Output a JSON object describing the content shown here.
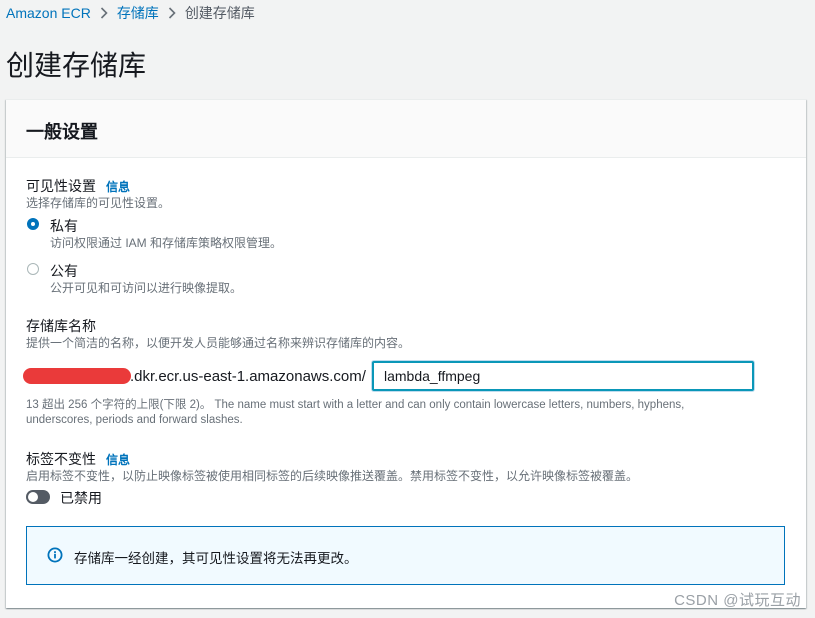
{
  "breadcrumb": {
    "root": "Amazon ECR",
    "parent": "存储库",
    "current": "创建存储库"
  },
  "page_title": "创建存储库",
  "general": {
    "title": "一般设置",
    "visibility": {
      "label": "可见性设置",
      "info": "信息",
      "description": "选择存储库的可见性设置。",
      "options": [
        {
          "label": "私有",
          "description": "访问权限通过 IAM 和存储库策略权限管理。",
          "selected": true
        },
        {
          "label": "公有",
          "description": "公开可见和可访问以进行映像提取。",
          "selected": false
        }
      ]
    },
    "repo_name": {
      "label": "存储库名称",
      "description": "提供一个简洁的名称，以便开发人员能够通过名称来辨识存储库的内容。",
      "uri_suffix": ".dkr.ecr.us-east-1.amazonaws.com/",
      "value": "lambda_ffmpeg",
      "constraint": "13 超出 256 个字符的上限(下限 2)。 The name must start with a letter and can only contain lowercase letters, numbers, hyphens, underscores, periods and forward slashes."
    },
    "tag_immutability": {
      "label": "标签不变性",
      "info": "信息",
      "description": "启用标签不变性，以防止映像标签被使用相同标签的后续映像推送覆盖。禁用标签不变性，以允许映像标签被覆盖。",
      "toggle_label": "已禁用",
      "enabled": false
    },
    "alert": {
      "icon": "info-icon",
      "text": "存储库一经创建，其可见性设置将无法再更改。"
    }
  },
  "watermark": "CSDN @试玩互动",
  "colors": {
    "link": "#0073bb",
    "focus_border": "#0a97b8",
    "redaction": "#ea3a3a",
    "alert_bg": "#f1faff"
  }
}
